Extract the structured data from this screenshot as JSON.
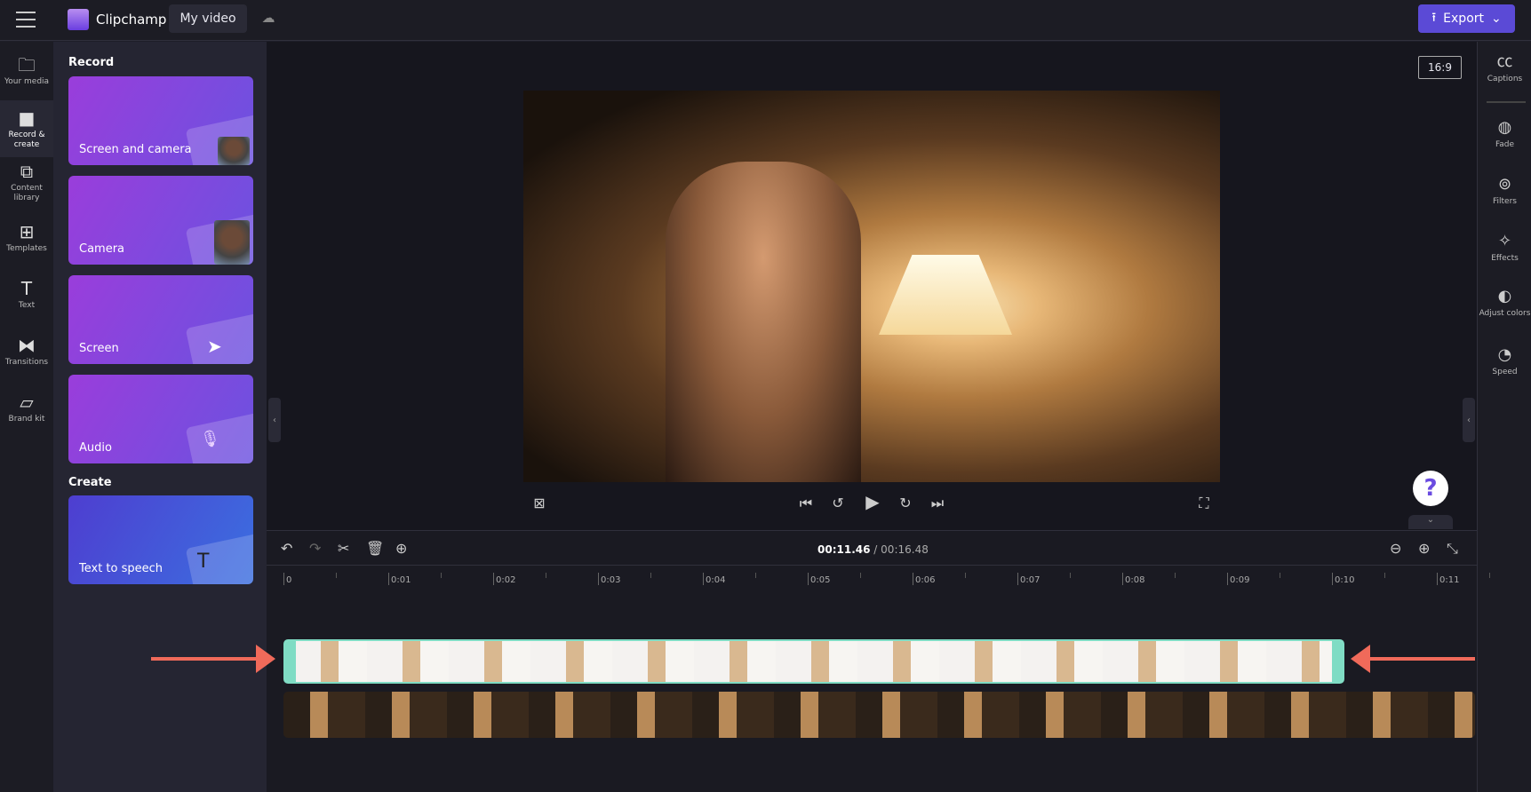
{
  "app": {
    "name": "Clipchamp",
    "project_title": "My video",
    "export_label": "Export"
  },
  "nav": [
    {
      "label": "Your media",
      "icon": "folder-icon"
    },
    {
      "label": "Record & create",
      "icon": "camera-icon"
    },
    {
      "label": "Content library",
      "icon": "content-library-icon"
    },
    {
      "label": "Templates",
      "icon": "templates-icon"
    },
    {
      "label": "Text",
      "icon": "text-icon"
    },
    {
      "label": "Transitions",
      "icon": "transitions-icon"
    },
    {
      "label": "Brand kit",
      "icon": "brand-kit-icon"
    }
  ],
  "panel": {
    "record_heading": "Record",
    "create_heading": "Create",
    "cards": [
      "Screen and camera",
      "Camera",
      "Screen",
      "Audio"
    ],
    "create_cards": [
      "Text to speech"
    ]
  },
  "preview": {
    "aspect_ratio": "16:9",
    "help": "?"
  },
  "right": [
    {
      "label": "Captions",
      "icon": "cc-icon"
    },
    {
      "label": "Fade",
      "icon": "fade-icon"
    },
    {
      "label": "Filters",
      "icon": "filters-icon"
    },
    {
      "label": "Effects",
      "icon": "effects-icon"
    },
    {
      "label": "Adjust colors",
      "icon": "adjust-colors-icon"
    },
    {
      "label": "Speed",
      "icon": "speed-icon"
    }
  ],
  "timeline": {
    "current": "00:11.46",
    "separator": "/",
    "total": "00:16.48",
    "ticks": [
      "0",
      "0:01",
      "0:02",
      "0:03",
      "0:04",
      "0:05",
      "0:06",
      "0:07",
      "0:08",
      "0:09",
      "0:10",
      "0:11"
    ]
  },
  "colors": {
    "accent": "#5b4ad6",
    "clip_border": "#7fdcc4",
    "arrow": "#f06a5a"
  }
}
